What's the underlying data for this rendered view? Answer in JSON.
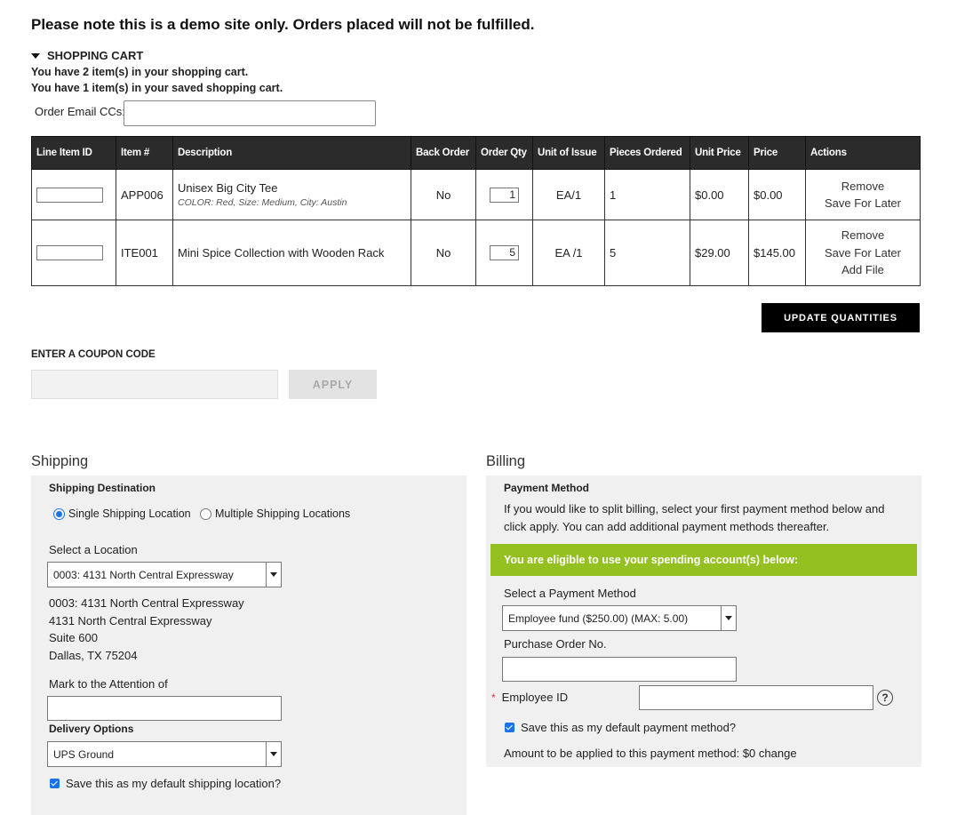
{
  "notice": "Please note this is a demo site only. Orders placed will not be fulfilled.",
  "cart": {
    "toggle_label": "SHOPPING CART",
    "count_text": "You have 2 item(s) in your shopping cart.",
    "saved_text": "You have 1 item(s) in your saved shopping cart.",
    "email_cc_label": "Order Email CCs:",
    "email_cc_value": "",
    "columns": [
      "Line Item ID",
      "Item #",
      "Description",
      "Back Order",
      "Order Qty",
      "Unit of Issue",
      "Pieces Ordered",
      "Unit Price",
      "Price",
      "Actions"
    ],
    "rows": [
      {
        "line_item_id": "",
        "item_no": "APP006",
        "description": "Unisex Big City Tee",
        "options": "COLOR: Red, Size: Medium, City: Austin",
        "back_order": "No",
        "order_qty": "1",
        "unit_of_issue": "EA/1",
        "pieces_ordered": "1",
        "unit_price": "$0.00",
        "price": "$0.00",
        "actions": [
          "Remove",
          "Save For Later"
        ]
      },
      {
        "line_item_id": "",
        "item_no": "ITE001",
        "description": "Mini Spice Collection with Wooden Rack",
        "options": "",
        "back_order": "No",
        "order_qty": "5",
        "unit_of_issue": "EA /1",
        "pieces_ordered": "5",
        "unit_price": "$29.00",
        "price": "$145.00",
        "actions": [
          "Remove",
          "Save For Later",
          "Add File"
        ]
      }
    ],
    "update_button": "UPDATE QUANTITIES"
  },
  "coupon": {
    "heading": "ENTER A COUPON CODE",
    "value": "",
    "apply_button": "APPLY"
  },
  "shipping": {
    "title": "Shipping",
    "destination_label": "Shipping Destination",
    "radio_single": "Single Shipping Location",
    "radio_multiple": "Multiple Shipping Locations",
    "selected_radio": "single",
    "location_label": "Select a Location",
    "location_value": "0003: 4131 North Central Expressway",
    "address": [
      "0003: 4131 North Central Expressway",
      "4131 North Central Expressway",
      "Suite 600",
      "Dallas, TX 75204"
    ],
    "attention_label": "Mark to the Attention of",
    "attention_value": "",
    "delivery_label": "Delivery Options",
    "delivery_value": "UPS Ground",
    "default_checkbox": "Save this as my default shipping location?",
    "default_checked": true
  },
  "billing": {
    "title": "Billing",
    "payment_method_label": "Payment Method",
    "split_text": "If you would like to split billing, select your first payment method below and click apply. You can add additional payment methods thereafter.",
    "eligible_banner": "You are eligible to use your spending account(s) below:",
    "select_label": "Select a Payment Method",
    "select_value": "Employee fund ($250.00) (MAX: 5.00)",
    "po_label": "Purchase Order No.",
    "po_value": "",
    "employee_id_label": "Employee ID",
    "employee_id_required": "*",
    "employee_id_value": "",
    "help_glyph": "?",
    "default_checkbox": "Save this as my default payment method?",
    "default_checked": true,
    "amount_text": "Amount to be applied to this payment method: $0",
    "change_link": "change"
  },
  "colors": {
    "header_bg": "#2b2b2b",
    "update_button_bg": "#000000",
    "eligible_banner_bg": "#94c11f",
    "panel_bg": "#f0f0f0",
    "accent": "#1a73e8"
  }
}
